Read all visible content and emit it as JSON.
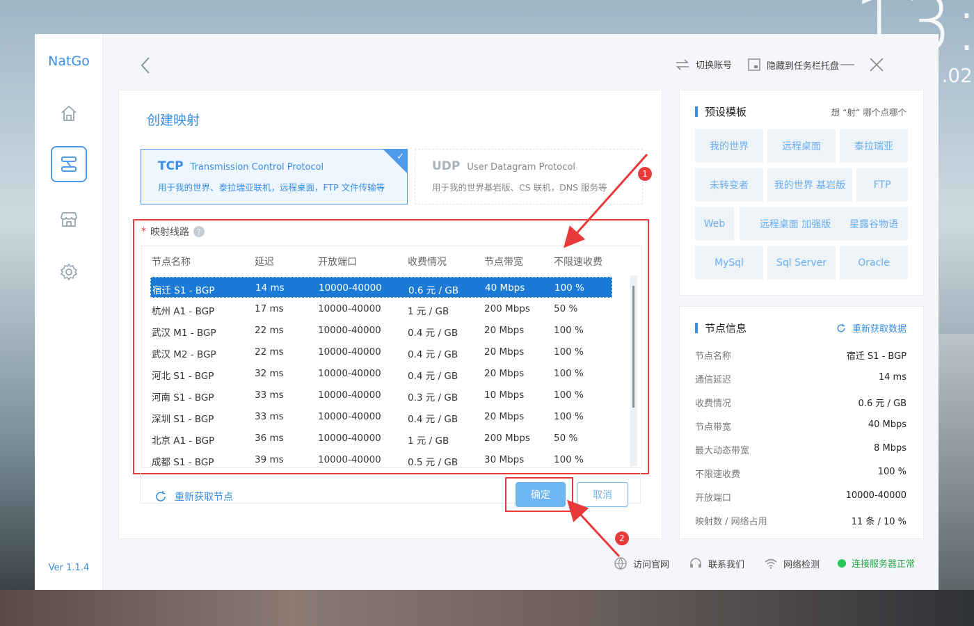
{
  "background": {
    "clock": "13:",
    "date": ".02"
  },
  "app": {
    "name": "NatGo",
    "version": "Ver 1.1.4"
  },
  "sidebar": {
    "items": [
      {
        "name": "home",
        "icon": "home-icon"
      },
      {
        "name": "mapping",
        "icon": "mapping-icon",
        "active": true
      },
      {
        "name": "store",
        "icon": "store-icon"
      },
      {
        "name": "settings",
        "icon": "gear-icon"
      }
    ]
  },
  "topbar": {
    "switch_account": "切换账号",
    "hide_to_tray": "隐藏到任务栏托盘"
  },
  "main": {
    "title": "创建映射",
    "tcp": {
      "abbr": "TCP",
      "full": "Transmission Control Protocol",
      "desc": "用于我的世界、泰拉瑞亚联机，远程桌面，FTP 文件传输等"
    },
    "udp": {
      "abbr": "UDP",
      "full": "User Datagram Protocol",
      "desc": "用于我的世界基岩版、CS 联机，DNS 服务等"
    },
    "route_label": "映射线路",
    "help": "?",
    "columns": [
      "节点名称",
      "延迟",
      "开放端口",
      "收费情况",
      "节点带宽",
      "不限速收费"
    ],
    "rows": [
      [
        "宿迁 S1 - BGP",
        "14 ms",
        "10000-40000",
        "0.6 元 / GB",
        "40 Mbps",
        "100 %"
      ],
      [
        "杭州 A1 - BGP",
        "17 ms",
        "10000-40000",
        "1 元 / GB",
        "200 Mbps",
        "50 %"
      ],
      [
        "武汉 M1 - BGP",
        "22 ms",
        "10000-40000",
        "0.4 元 / GB",
        "20 Mbps",
        "100 %"
      ],
      [
        "武汉 M2 - BGP",
        "22 ms",
        "10000-40000",
        "0.4 元 / GB",
        "20 Mbps",
        "100 %"
      ],
      [
        "河北 S1 - BGP",
        "32 ms",
        "10000-40000",
        "0.4 元 / GB",
        "20 Mbps",
        "100 %"
      ],
      [
        "河南 S1 - BGP",
        "33 ms",
        "10000-40000",
        "0.3 元 / GB",
        "10 Mbps",
        "100 %"
      ],
      [
        "深圳 S1 - BGP",
        "33 ms",
        "10000-40000",
        "0.4 元 / GB",
        "20 Mbps",
        "100 %"
      ],
      [
        "北京 A1 - BGP",
        "36 ms",
        "10000-40000",
        "1 元 / GB",
        "200 Mbps",
        "50 %"
      ],
      [
        "成都 S1 - BGP",
        "39 ms",
        "10000-40000",
        "0.5 元 / GB",
        "30 Mbps",
        "100 %"
      ]
    ],
    "selected_row": 0,
    "refetch_nodes": "重新获取节点",
    "confirm": "确定",
    "cancel": "取消"
  },
  "templates": {
    "title": "预设模板",
    "hint": "想 “射” 哪个点哪个",
    "items": [
      "我的世界",
      "远程桌面",
      "泰拉瑞亚",
      "未转变者",
      "我的世界 基岩版",
      "FTP",
      "Web",
      "远程桌面 加强版",
      "星露谷物语",
      "MySql",
      "Sql Server",
      "Oracle"
    ]
  },
  "node_info": {
    "title": "节点信息",
    "refresh": "重新获取数据",
    "rows": [
      [
        "节点名称",
        "宿迁 S1 - BGP"
      ],
      [
        "通信延迟",
        "14 ms"
      ],
      [
        "收费情况",
        "0.6 元 / GB"
      ],
      [
        "节点带宽",
        "40 Mbps"
      ],
      [
        "最大动态带宽",
        "8 Mbps"
      ],
      [
        "不限速收费",
        "100 %"
      ],
      [
        "开放端口",
        "10000-40000"
      ],
      [
        "映射数 / 网络占用",
        "11 条 / 10 %"
      ]
    ]
  },
  "status": {
    "website": "访问官网",
    "contact": "联系我们",
    "network_check": "网络检测",
    "connection": "连接服务器正常"
  },
  "annotations": {
    "a1": "1",
    "a2": "2"
  },
  "colors": {
    "accent": "#3a8ee6",
    "highlight": "#e83a3a",
    "selected": "#1b7ad6",
    "ok": "#28c85a"
  }
}
